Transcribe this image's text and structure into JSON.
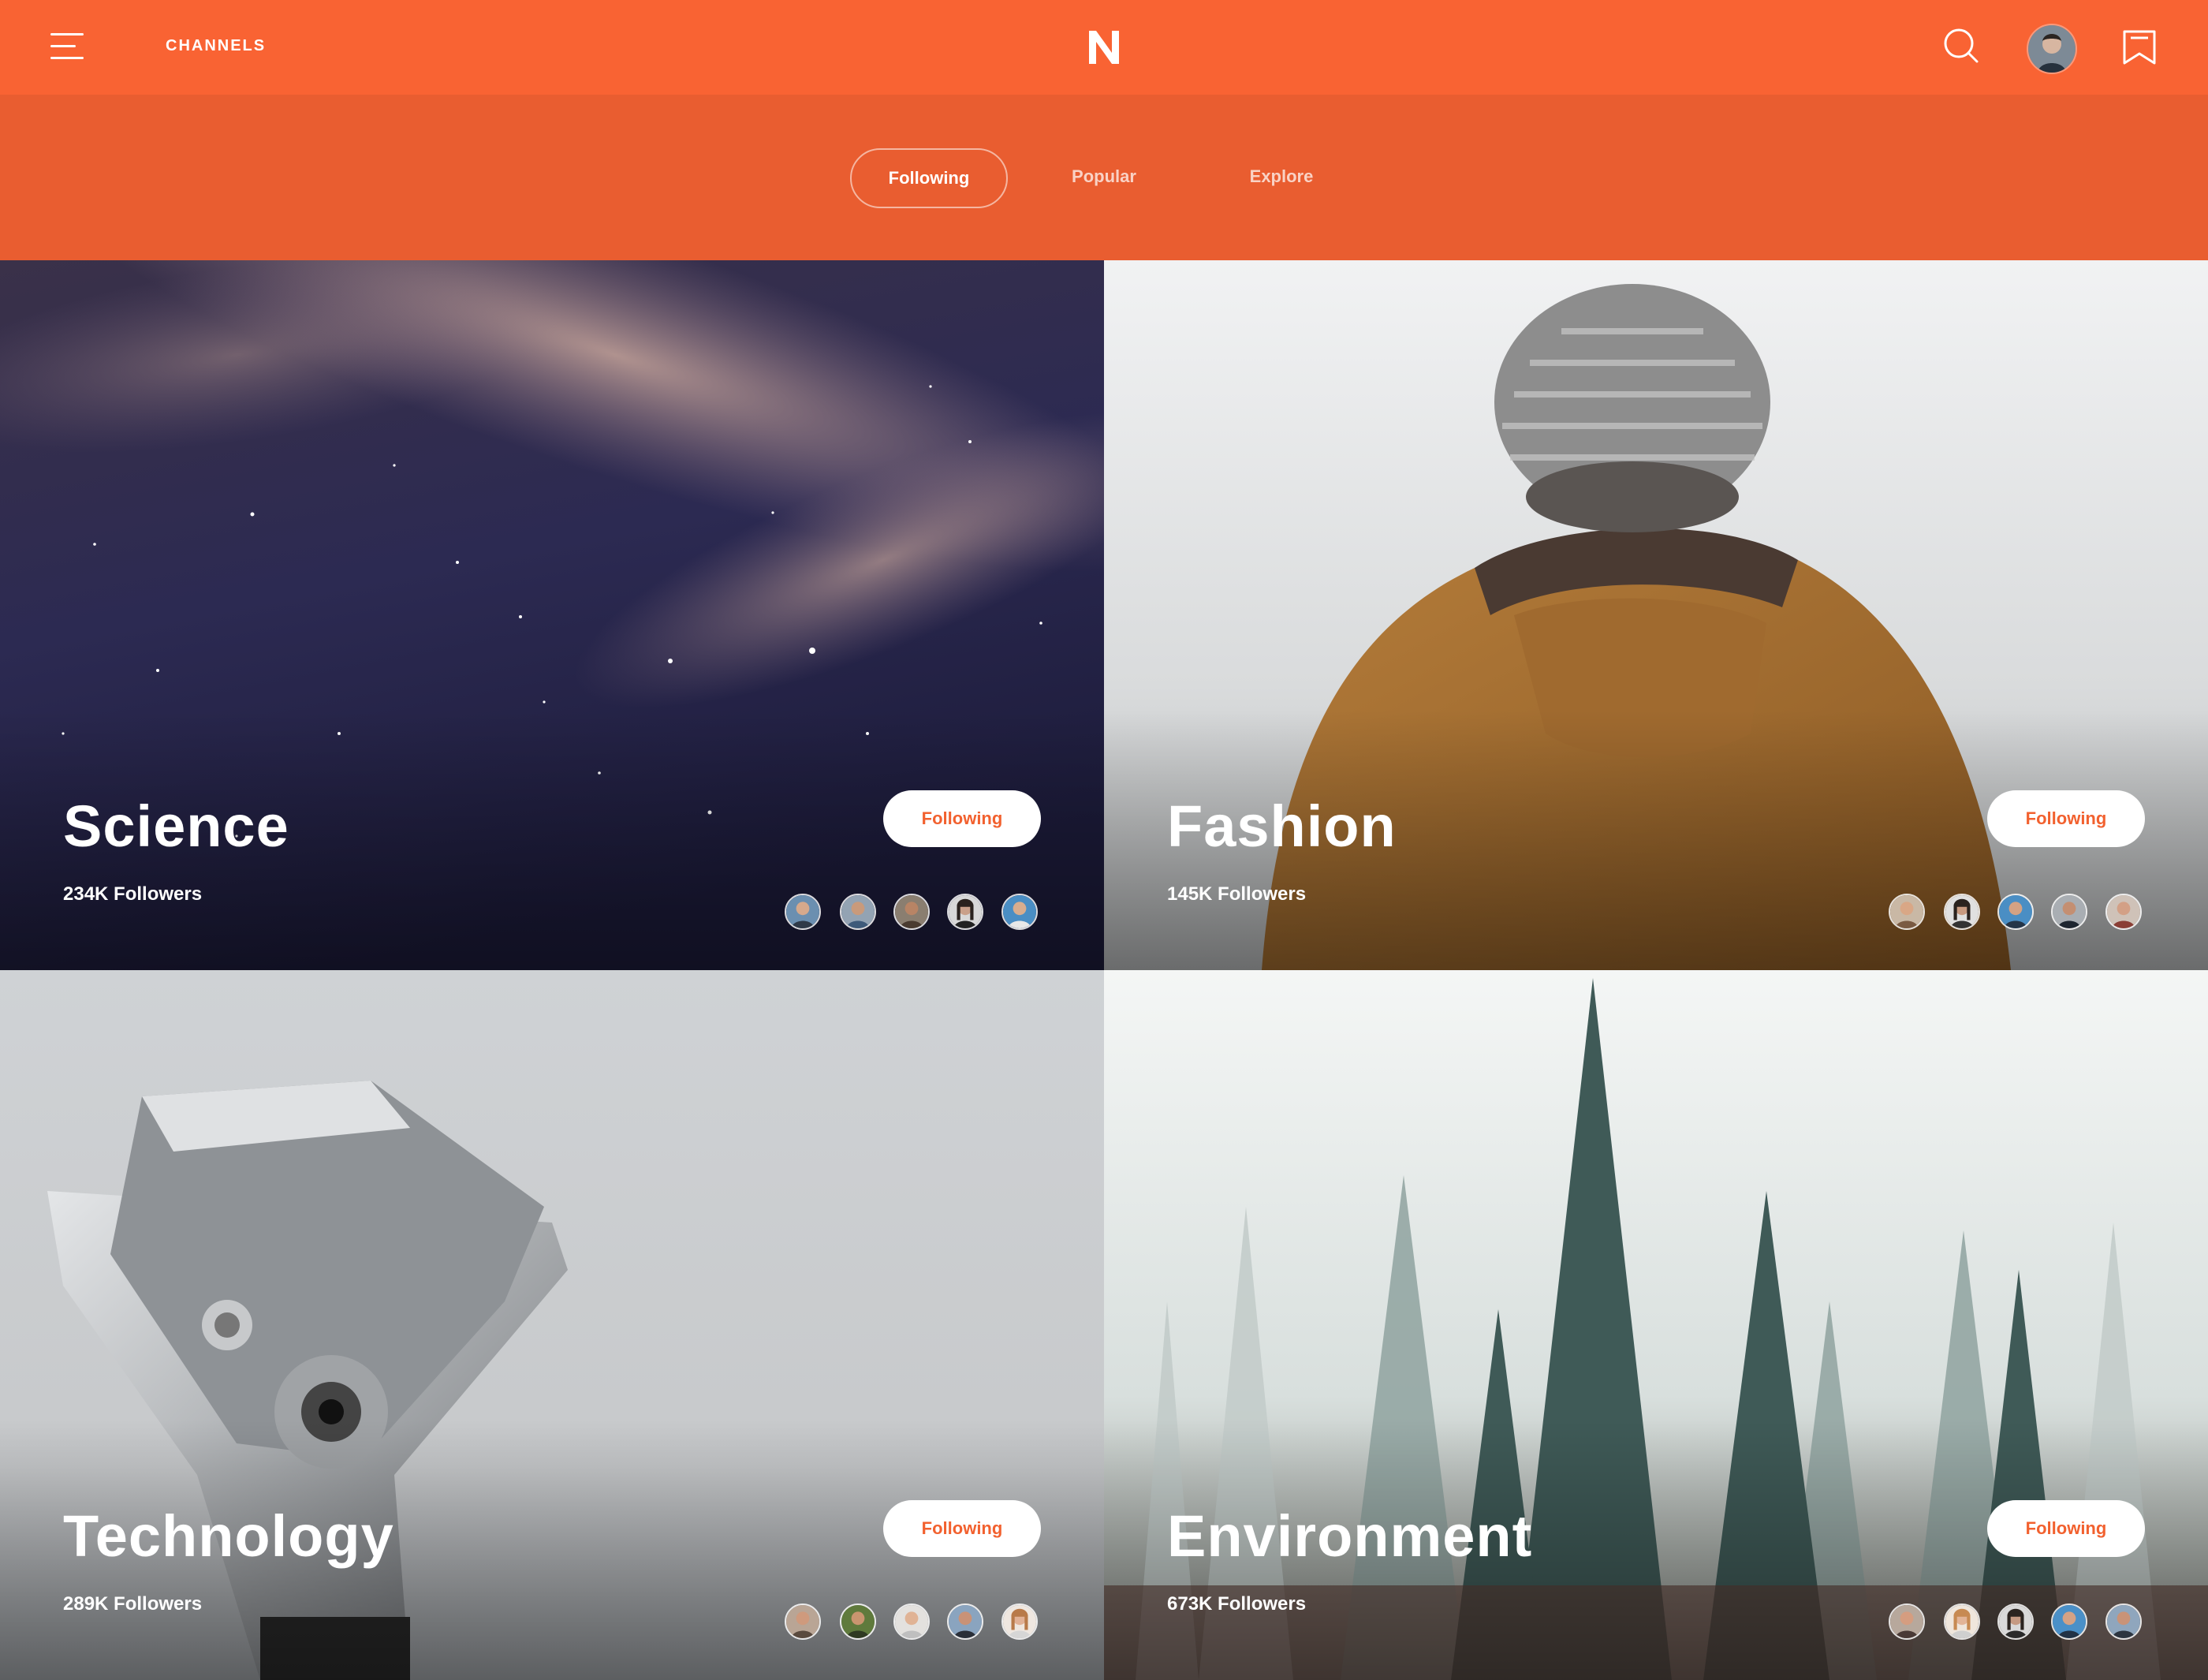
{
  "header": {
    "channels_label": "CHANNELS",
    "logo_letter": "N",
    "brand_color": "#f96333"
  },
  "tabs": [
    {
      "label": "Following",
      "active": true
    },
    {
      "label": "Popular",
      "active": false
    },
    {
      "label": "Explore",
      "active": false
    }
  ],
  "cards": [
    {
      "title": "Science",
      "followers": "234K Followers",
      "button": "Following"
    },
    {
      "title": "Fashion",
      "followers": "145K Followers",
      "button": "Following"
    },
    {
      "title": "Technology",
      "followers": "289K Followers",
      "button": "Following"
    },
    {
      "title": "Environment",
      "followers": "673K Followers",
      "button": "Following"
    }
  ],
  "icons": [
    "menu-icon",
    "search-icon",
    "bookmark-icon"
  ]
}
